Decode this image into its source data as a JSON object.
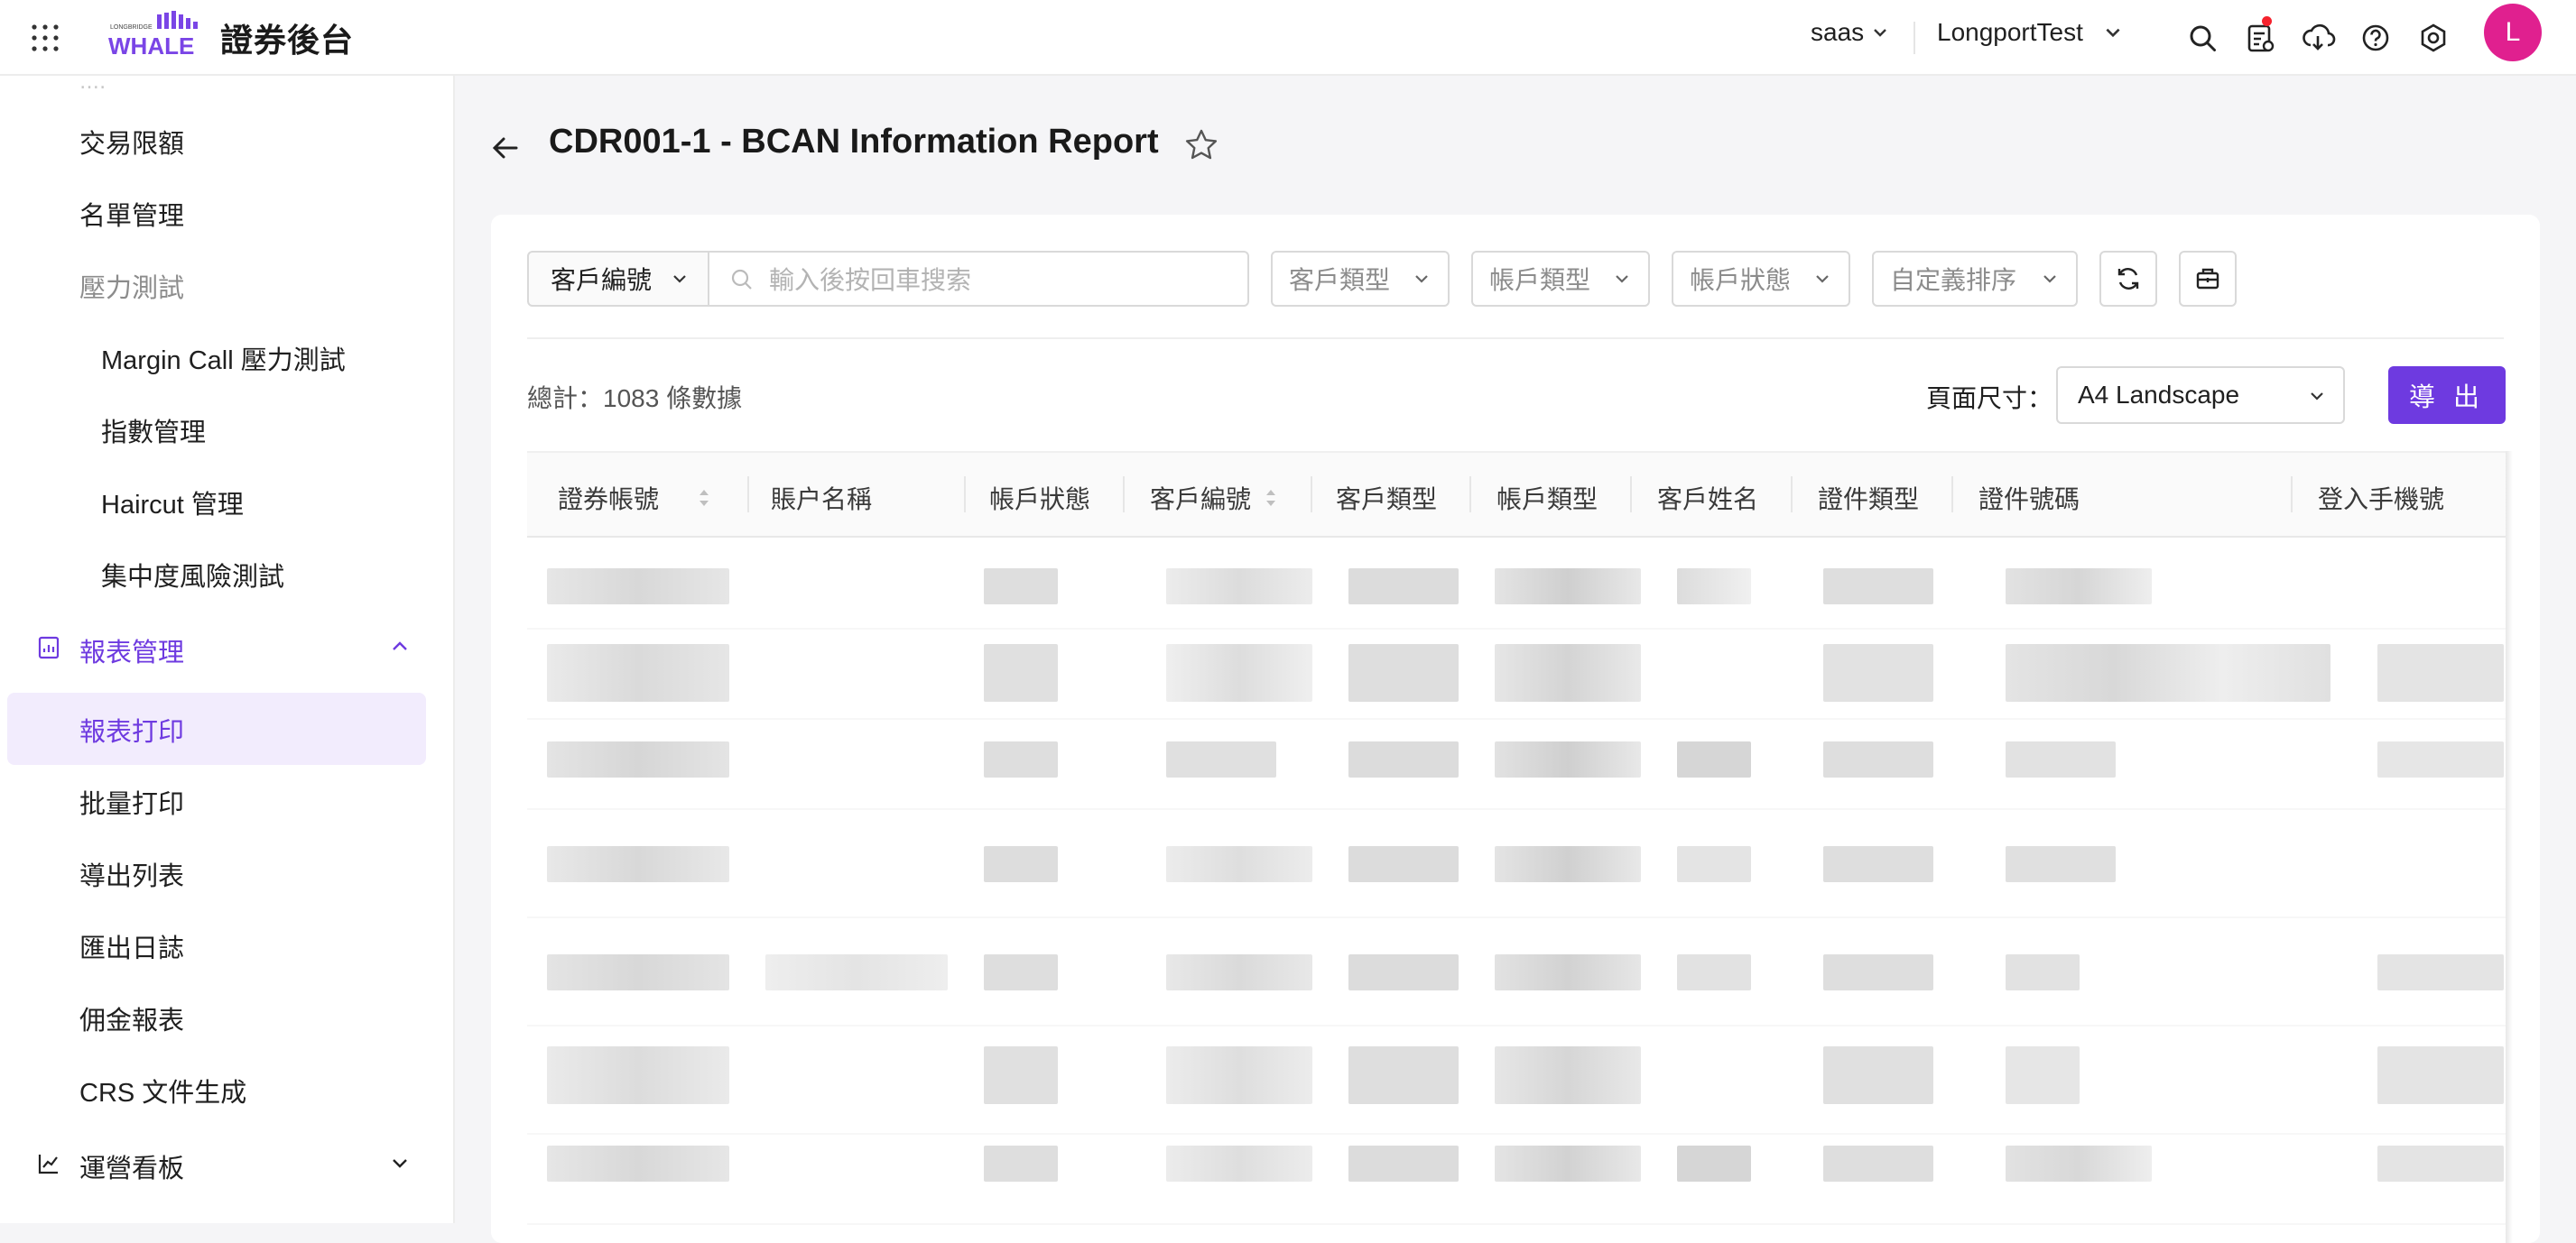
{
  "app": {
    "title": "證券後台",
    "logo_text": "WHALE",
    "logo_small": "LONGBRIDGE"
  },
  "header": {
    "env": "saas",
    "tenant": "LongportTest",
    "avatar_letter": "L",
    "icons": [
      "grid-icon",
      "search-icon",
      "task-list-icon",
      "download-cloud-icon",
      "help-icon",
      "settings-icon"
    ],
    "notification_color": "#f5222d"
  },
  "sidebar": {
    "items": [
      {
        "label": "交易限額"
      },
      {
        "label": "名單管理"
      },
      {
        "label": "壓力測試"
      },
      {
        "label": "Margin Call 壓力測試"
      },
      {
        "label": "指數管理"
      },
      {
        "label": "Haircut 管理"
      },
      {
        "label": "集中度風險測試"
      },
      {
        "label": "報表管理"
      },
      {
        "label": "報表打印"
      },
      {
        "label": "批量打印"
      },
      {
        "label": "導出列表"
      },
      {
        "label": "匯出日誌"
      },
      {
        "label": "佣金報表"
      },
      {
        "label": "CRS 文件生成"
      },
      {
        "label": "運營看板"
      }
    ]
  },
  "page": {
    "title": "CDR001-1 - BCAN Information Report"
  },
  "toolbar": {
    "search_field": "客戶編號",
    "search_placeholder": "輸入後按回車搜索",
    "filters": [
      "客戶類型",
      "帳戶類型",
      "帳戶狀態",
      "自定義排序"
    ]
  },
  "summary": {
    "total": "總計：1083 條數據",
    "page_size_label": "頁面尺寸：",
    "page_size_value": "A4 Landscape",
    "export_label": "導 出"
  },
  "table": {
    "columns": [
      "證券帳號",
      "賬户名稱",
      "帳戶狀態",
      "客戶編號",
      "客戶類型",
      "帳戶類型",
      "客戶姓名",
      "證件類型",
      "證件號碼",
      "登入手機號"
    ]
  },
  "colors": {
    "accent": "#6e3ae0",
    "selected_bg": "#f2ecfd",
    "avatar": "#e0208f"
  }
}
